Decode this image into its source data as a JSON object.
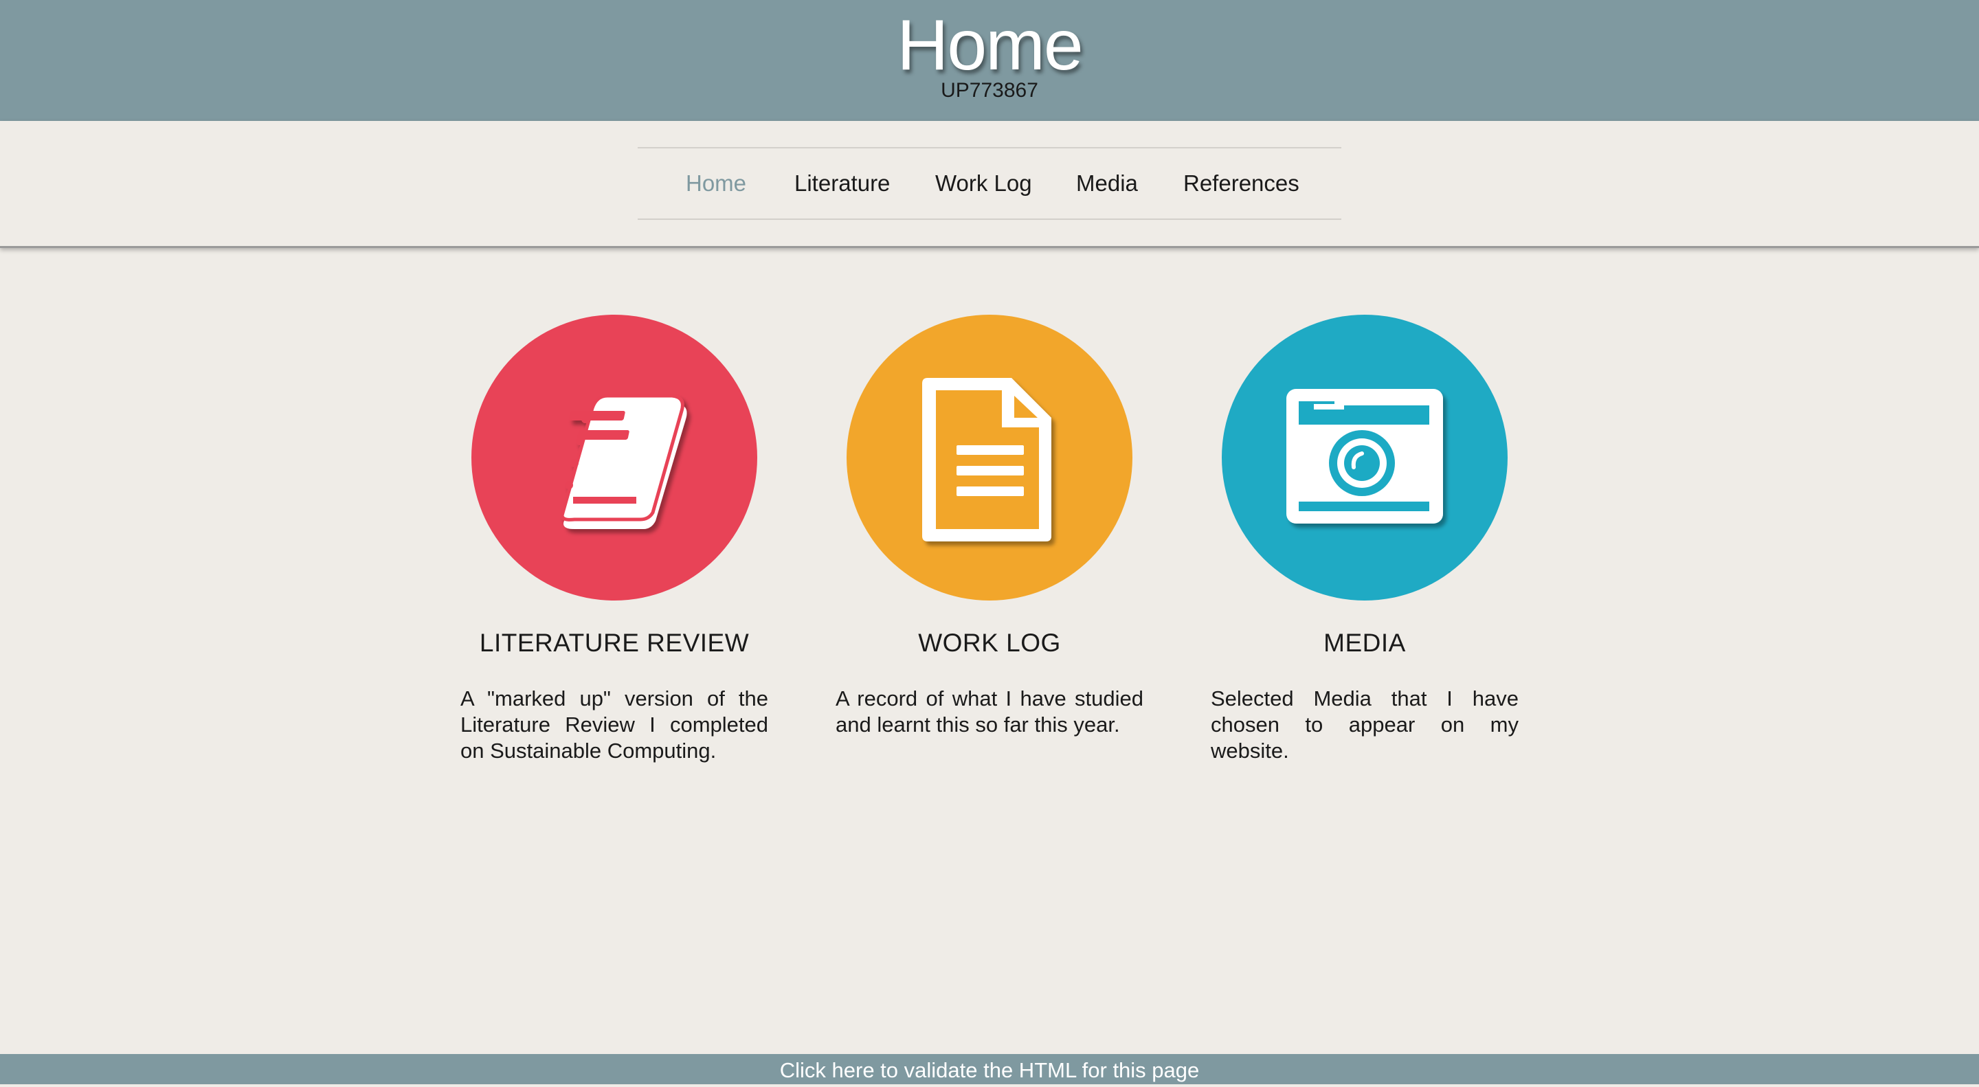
{
  "header": {
    "title": "Home",
    "subtitle": "UP773867"
  },
  "nav": {
    "items": [
      {
        "label": "Home",
        "active": true
      },
      {
        "label": "Literature",
        "active": false
      },
      {
        "label": "Work Log",
        "active": false
      },
      {
        "label": "Media",
        "active": false
      },
      {
        "label": "References",
        "active": false
      }
    ]
  },
  "cards": [
    {
      "icon": "book-icon",
      "color": "#e84357",
      "title": "LITERATURE REVIEW",
      "text": "A \"marked up\" version of the Literature Review I completed on Sustainable Computing."
    },
    {
      "icon": "document-icon",
      "color": "#f2a62b",
      "title": "WORK LOG",
      "text": "A record of what I have studied and learnt this so far this year."
    },
    {
      "icon": "camera-icon",
      "color": "#1faac4",
      "title": "MEDIA",
      "text": "Selected Media that I have chosen to appear on my website."
    }
  ],
  "footer": {
    "text": "Click here to validate the HTML for this page"
  }
}
